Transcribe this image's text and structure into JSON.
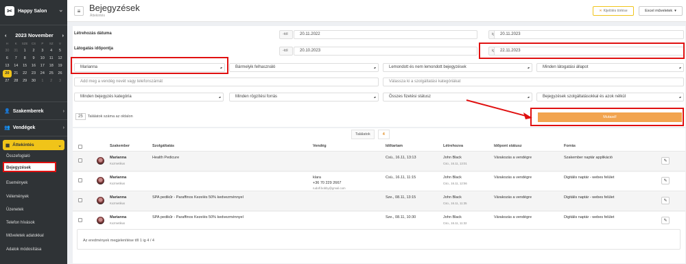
{
  "sidebar": {
    "brand": "Happy Salon",
    "calendar": {
      "month": "2023 November",
      "prev": "‹",
      "next": "›",
      "day_names": [
        "H",
        "K",
        "SZE",
        "CS",
        "P",
        "SZ",
        "V"
      ],
      "weeks": [
        [
          "30",
          "31",
          "1",
          "2",
          "3",
          "4",
          "5"
        ],
        [
          "6",
          "7",
          "8",
          "9",
          "10",
          "11",
          "12"
        ],
        [
          "13",
          "14",
          "15",
          "16",
          "17",
          "18",
          "19"
        ],
        [
          "20",
          "21",
          "22",
          "23",
          "24",
          "25",
          "26"
        ],
        [
          "27",
          "28",
          "29",
          "30",
          "1",
          "2",
          "3"
        ]
      ],
      "selected": "20"
    },
    "sections": [
      {
        "label": "Szakemberek"
      },
      {
        "label": "Vendégek"
      }
    ],
    "active_section": "Áttekintés",
    "sub_items": [
      "Összefoglaló",
      "Bejegyzések",
      "Események",
      "Vélemények",
      "Üzenetek",
      "Telefon hívások",
      "Műveletek adatokkal",
      "Adatok módosítása"
    ]
  },
  "header": {
    "title": "Bejegyzések",
    "subtitle": "Áttekintés",
    "clear_filters": "Kijelölés törlése",
    "excel": "Excel műveletek"
  },
  "filters": {
    "created_label": "Létrehozás dátuma",
    "visit_label": "Látogatás időpontja",
    "from": "-tól",
    "to": "ig",
    "created_from": "20.11.2022",
    "created_to": "20.11.2023",
    "visit_from": "20.10.2023",
    "visit_to": "22.11.2023",
    "specialist": "Marianna",
    "any_user": "Bármelyik felhasználó",
    "deleted": "Lemondott és nem lemondott bejegyzések",
    "visit_status": "Minden látogatási állapot",
    "guest_placeholder": "Add meg a vendég nevét vagy telefonszámát",
    "service_category_placeholder": "Válassza ki a szolgáltatási kategóriákat",
    "entry_category": "Minden bejegyzés kategória",
    "source": "Minden rögzítési forrás",
    "payment": "Összes fizetési státusz",
    "services_filter": "Bejegyzések szolgáltatásokkal és azok nélkül",
    "per_page": "25",
    "per_page_label": "Találatok száma az oldalon",
    "search": "Mutasd!"
  },
  "results": {
    "tab_label": "Találatok",
    "count": "4",
    "columns": [
      "Szakember",
      "Szolgáltatás",
      "Vendég",
      "Időtartam",
      "Létrehozva",
      "Időpont státusz",
      "Forrás"
    ],
    "rows": [
      {
        "name": "Marianna",
        "role": "Kozmetikus",
        "service": "Health Pedicure",
        "guest": "",
        "guest_phone": "",
        "guest_email": "",
        "time": "Csü., 16.11, 13:13",
        "creator": "John Black",
        "created": "Csü., 16.11, 13:01",
        "status": "Várakozás a vendégre",
        "source": "Szakember naptár applikáció"
      },
      {
        "name": "Marianna",
        "role": "Kozmetikus",
        "service": "",
        "guest": "klara",
        "guest_phone": "+36 70 229 2667",
        "guest_email": "rudolf.bobby@gmail.com",
        "time": "Csü., 16.11, 11:15",
        "creator": "John Black",
        "created": "Csü., 16.11, 12:56",
        "status": "Várakozás a vendégre",
        "source": "Digitális naptár - webes felület"
      },
      {
        "name": "Marianna",
        "role": "Kozmetikus",
        "service": "SPA pedikűr - Paraffinos Kezelés 50% kedvezménnyel",
        "guest": "",
        "guest_phone": "",
        "guest_email": "",
        "time": "Sze., 08.11, 13:15",
        "creator": "John Black",
        "created": "Csü., 16.11, 11:35",
        "status": "Várakozás a vendégre",
        "source": "Digitális naptár - webes felület"
      },
      {
        "name": "Marianna",
        "role": "Kozmetikus",
        "service": "SPA pedikűr - Paraffinos Kezelés 50% kedvezménnyel",
        "guest": "",
        "guest_phone": "",
        "guest_email": "",
        "time": "Sze., 08.11, 10:30",
        "creator": "John Black",
        "created": "Csü., 16.11, 11:32",
        "status": "Várakozás a vendégre",
        "source": "Digitális naptár - webes felület"
      }
    ],
    "footer": "Az eredmények megjelenítése től 1 ig 4 / 4"
  },
  "colors": {
    "accent": "#f0c419",
    "sidebar": "#2f3336",
    "search_button": "#f2a44f",
    "highlight": "#e01010"
  },
  "icons": [
    "hamburger-icon",
    "chevron-down-icon",
    "user-icon",
    "users-icon",
    "grid-icon",
    "close-icon",
    "edit-icon"
  ]
}
